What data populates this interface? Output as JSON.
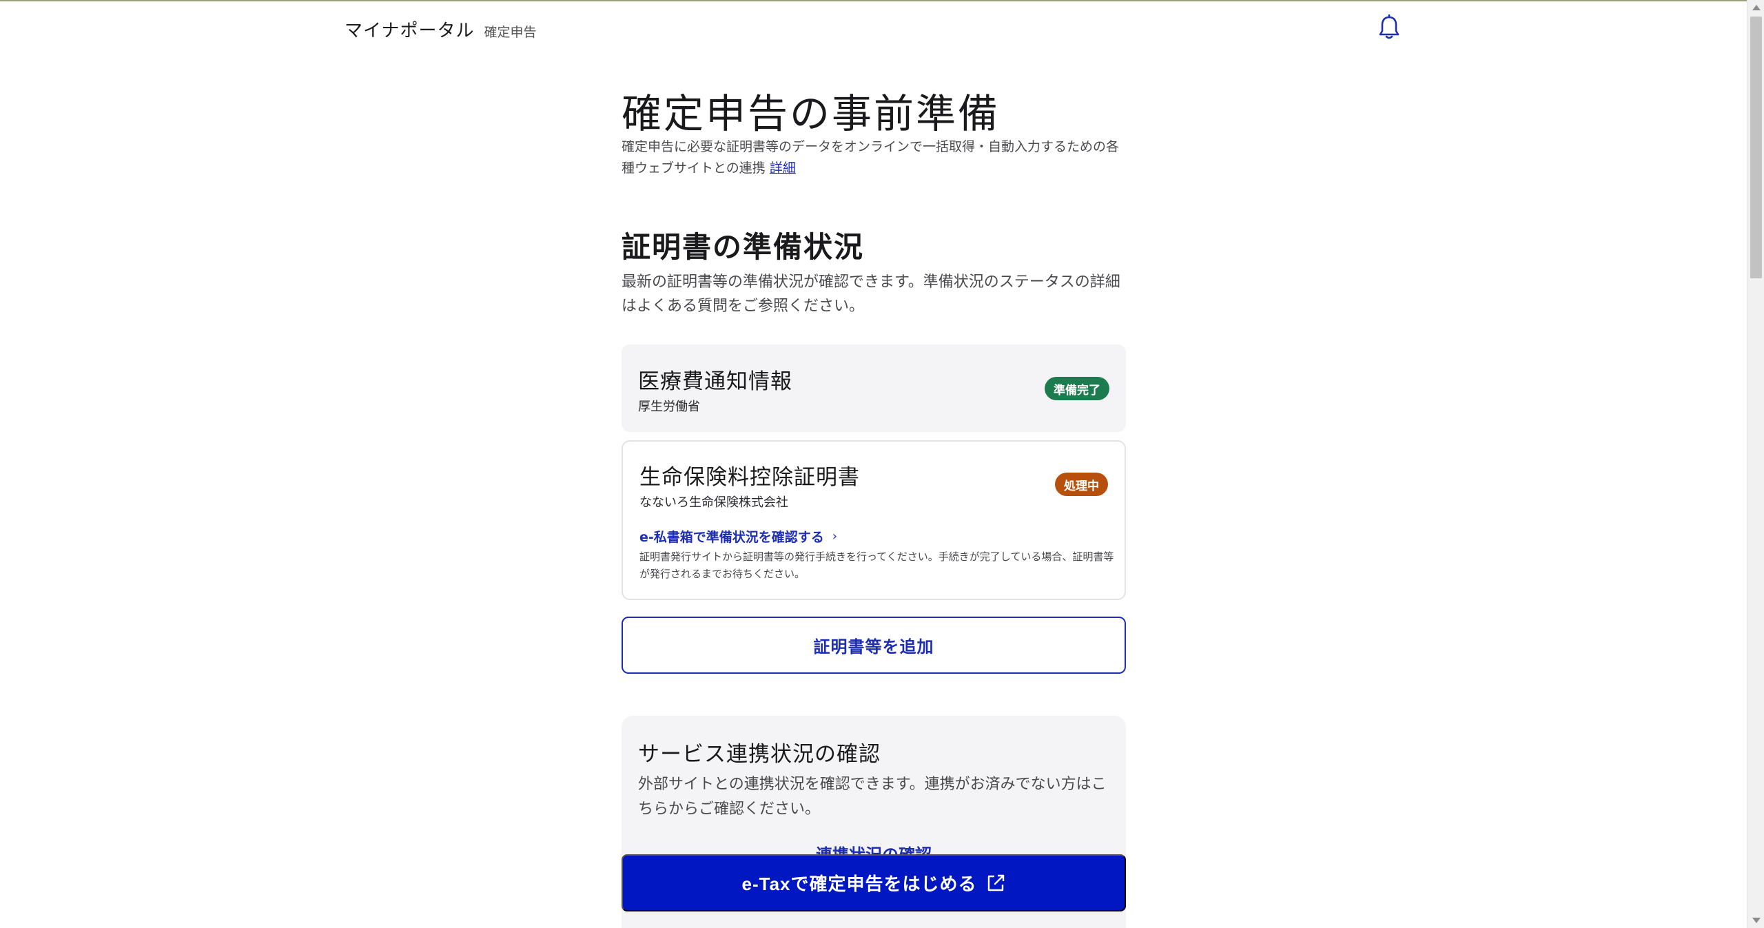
{
  "header": {
    "brand": "マイナポータル",
    "section": "確定申告",
    "notification_icon": "bell-icon"
  },
  "page": {
    "title": "確定申告の事前準備",
    "description": "確定申告に必要な証明書等のデータをオンラインで一括取得・自動入力するための各種ウェブサイトとの連携",
    "detail_link": "詳細"
  },
  "certificates": {
    "title": "証明書の準備状況",
    "description": "最新の証明書等の準備状況が確認できます。準備状況のステータスの詳細はよくある質問をご参照ください。",
    "items": [
      {
        "title": "医療費通知情報",
        "issuer": "厚生労働省",
        "status": "準備完了",
        "status_color": "#1d7c4f"
      },
      {
        "title": "生命保険料控除証明書",
        "issuer": "なないろ生命保険株式会社",
        "status": "処理中",
        "status_color": "#b8500d",
        "link": "e-私書箱で準備状況を確認する",
        "note": "証明書発行サイトから証明書等の発行手続きを行ってください。手続きが完了している場合、証明書等が発行されるまでお待ちください。"
      }
    ],
    "add_button": "証明書等を追加"
  },
  "services": {
    "title": "サービス連携状況の確認",
    "description": "外部サイトとの連携状況を確認できます。連携がお済みでない方はこちらからご確認ください。",
    "link": "連携状況の確認"
  },
  "cta": {
    "label": "e-Taxで確定申告をはじめる",
    "icon": "external-link-icon"
  },
  "colors": {
    "accent": "#1d2eb3",
    "primary_button": "#0017c1",
    "card_bg": "#f4f4f6"
  }
}
